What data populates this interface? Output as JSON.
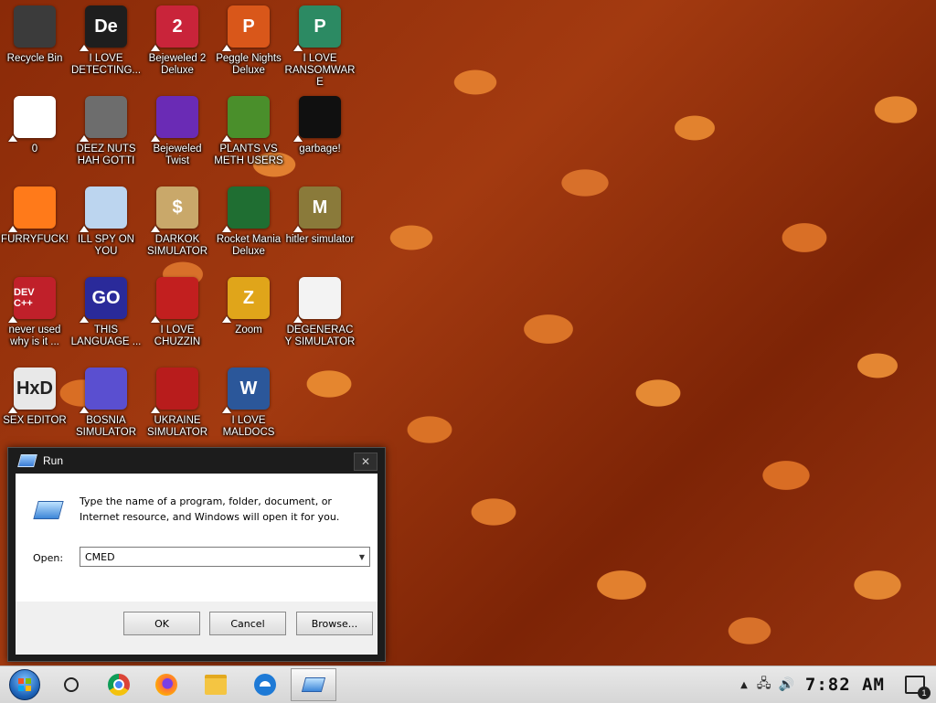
{
  "desktop": {
    "icons": [
      {
        "label": "Recycle Bin",
        "glyph": "",
        "color": "#3b3b3b"
      },
      {
        "label": "I LOVE DETECTING...",
        "glyph": "De",
        "color": "#1e1e1e"
      },
      {
        "label": "Bejeweled 2 Deluxe",
        "glyph": "2",
        "color": "#c9243a"
      },
      {
        "label": "Peggle Nights Deluxe",
        "glyph": "P",
        "color": "#d9571a"
      },
      {
        "label": "I LOVE RANSOMWARE",
        "glyph": "P",
        "color": "#2c8a63"
      },
      {
        "label": "0",
        "glyph": "",
        "color": "#ffffff"
      },
      {
        "label": "DEEZ NUTS HAH GOTTI",
        "glyph": "",
        "color": "#6d6d6d"
      },
      {
        "label": "Bejeweled Twist",
        "glyph": "",
        "color": "#6a2bb5"
      },
      {
        "label": "PLANTS VS METH USERS",
        "glyph": "",
        "color": "#4a8f2b"
      },
      {
        "label": "garbage!",
        "glyph": "",
        "color": "#101010"
      },
      {
        "label": "FURRYFUCK!",
        "glyph": "",
        "color": "#ff7a1a"
      },
      {
        "label": "ILL SPY ON YOU",
        "glyph": "",
        "color": "#bcd5ef"
      },
      {
        "label": "DARKOK SIMULATOR",
        "glyph": "$",
        "color": "#c9a86a"
      },
      {
        "label": "Rocket Mania Deluxe",
        "glyph": "",
        "color": "#1f6e32"
      },
      {
        "label": "hitler simulator",
        "glyph": "M",
        "color": "#8a7a3a"
      },
      {
        "label": "never used why is it ...",
        "glyph": "DEV C++",
        "color": "#c0202a"
      },
      {
        "label": "THIS LANGUAGE ...",
        "glyph": "GO",
        "color": "#2a2a9a"
      },
      {
        "label": "I LOVE CHUZZIN",
        "glyph": "",
        "color": "#c21f1f"
      },
      {
        "label": "Zoom",
        "glyph": "Z",
        "color": "#e0a51a"
      },
      {
        "label": "DEGENERACY SIMULATOR",
        "glyph": "",
        "color": "#f3f3f3"
      },
      {
        "label": "SEX EDITOR",
        "glyph": "HxD",
        "color": "#e8e8e8"
      },
      {
        "label": "BOSNIA SIMULATOR",
        "glyph": "",
        "color": "#5a4fd0"
      },
      {
        "label": "UKRAINE SIMULATOR",
        "glyph": "",
        "color": "#b81c1c"
      },
      {
        "label": "I LOVE MALDOCS",
        "glyph": "W",
        "color": "#2b579a"
      }
    ]
  },
  "run_dialog": {
    "title": "Run",
    "close_glyph": "✕",
    "description": "Type the name of a program, folder, document, or Internet resource, and Windows will open it for you.",
    "open_label": "Open:",
    "open_value": "CMED",
    "dropdown_glyph": "▼",
    "ok": "OK",
    "cancel": "Cancel",
    "browse": "Browse..."
  },
  "taskbar": {
    "tray_chevron": "▲",
    "network_glyph": "🖧",
    "volume_glyph": "🔊",
    "clock": "7:82 AM"
  }
}
